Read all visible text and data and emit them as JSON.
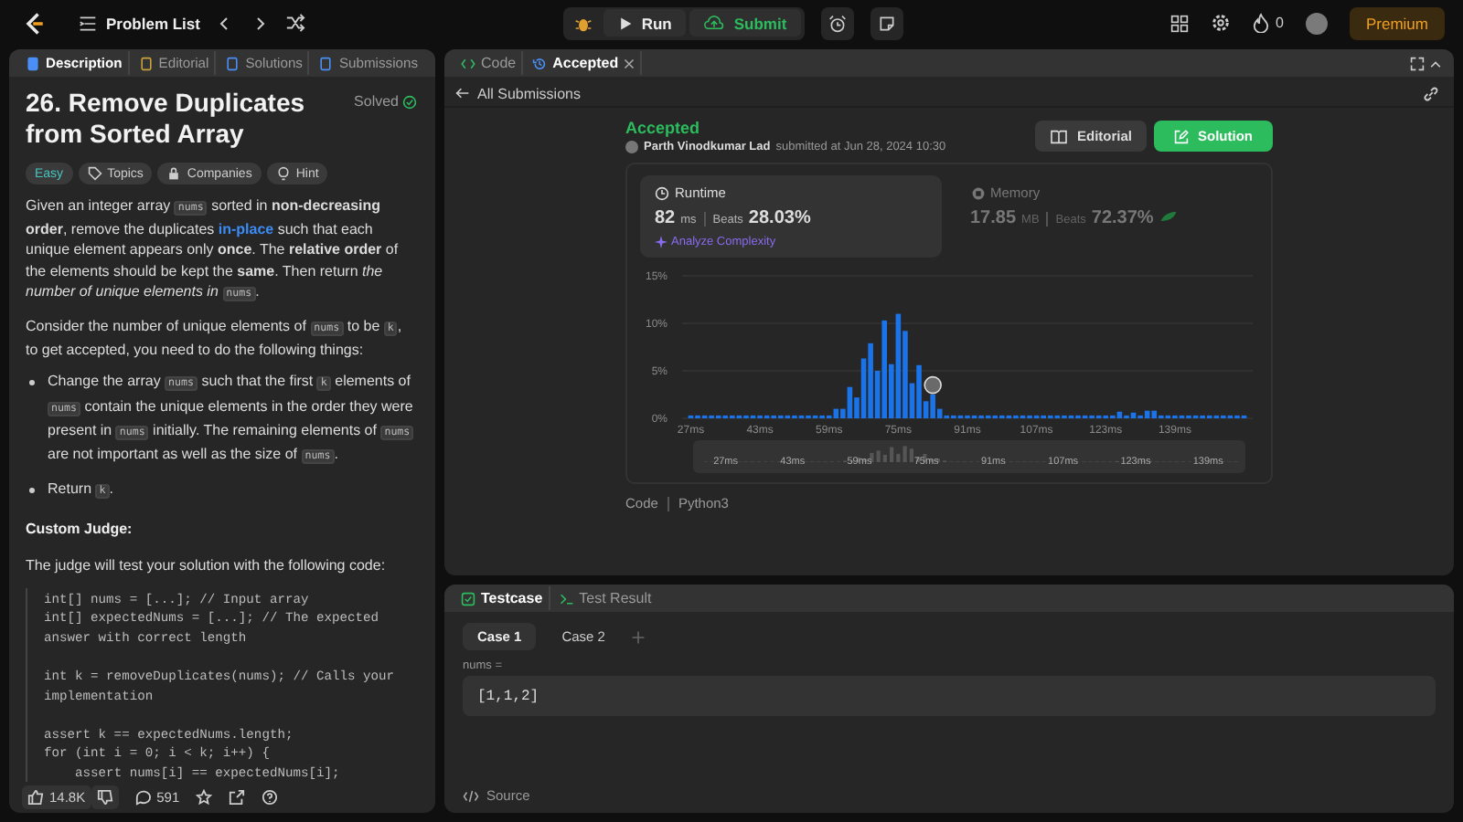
{
  "top_bar": {
    "title": "Problem List",
    "run": "Run",
    "submit": "Submit",
    "streak": "0",
    "premium": "Premium"
  },
  "left_tabs": [
    {
      "label": "Description",
      "kind": "doc",
      "selected": true
    },
    {
      "label": "Editorial",
      "kind": "book",
      "selected": false
    },
    {
      "label": "Solutions",
      "kind": "flask",
      "selected": false
    },
    {
      "label": "Submissions",
      "kind": "history",
      "selected": false
    }
  ],
  "problem": {
    "title": "26. Remove Duplicates from Sorted Array",
    "status": "Solved",
    "difficulty": "Easy",
    "tags": [
      {
        "label": "Topics",
        "kind": "tag"
      },
      {
        "label": "Companies",
        "kind": "lock"
      },
      {
        "label": "Hint",
        "kind": "bulb"
      }
    ],
    "paragraphs": [
      {
        "kind": "para",
        "segments": [
          {
            "kind": "text",
            "text": "Given an integer array "
          },
          {
            "kind": "code",
            "text": "nums"
          },
          {
            "kind": "text",
            "text": " sorted in **non-decreasing order**, remove the duplicates "
          },
          {
            "kind": "link",
            "text": "in-place"
          },
          {
            "kind": "text",
            "text": " such that each unique element appears only **once**. The **relative order** of the elements should be kept the **same**. Then return *the number of unique elements in* "
          },
          {
            "kind": "code",
            "text": "nums"
          },
          {
            "kind": "text",
            "text": "."
          }
        ]
      },
      {
        "kind": "para",
        "segments": [
          {
            "kind": "text",
            "text": "Consider the number of unique elements of "
          },
          {
            "kind": "code",
            "text": "nums"
          },
          {
            "kind": "text",
            "text": " to be "
          },
          {
            "kind": "code",
            "text": "k"
          },
          {
            "kind": "text",
            "text": ", to get accepted, you need to do the following things:"
          }
        ]
      },
      {
        "kind": "bullet",
        "segments": [
          {
            "kind": "text",
            "text": "Change the array "
          },
          {
            "kind": "code",
            "text": "nums"
          },
          {
            "kind": "text",
            "text": " such that the first "
          },
          {
            "kind": "code",
            "text": "k"
          },
          {
            "kind": "text",
            "text": " elements of "
          },
          {
            "kind": "code",
            "text": "nums"
          },
          {
            "kind": "text",
            "text": " contain the unique elements in the order they were present in "
          },
          {
            "kind": "code",
            "text": "nums"
          },
          {
            "kind": "text",
            "text": " initially. The remaining elements of "
          },
          {
            "kind": "code",
            "text": "nums"
          },
          {
            "kind": "text",
            "text": " are not important as well as the size of "
          },
          {
            "kind": "code",
            "text": "nums"
          },
          {
            "kind": "text",
            "text": "."
          }
        ]
      },
      {
        "kind": "bullet",
        "segments": [
          {
            "kind": "text",
            "text": "Return "
          },
          {
            "kind": "code",
            "text": "k"
          },
          {
            "kind": "text",
            "text": "."
          }
        ]
      }
    ],
    "judge_heading": "Custom Judge:",
    "judge_text": "The judge will test your solution with the following code:",
    "code": "int[] nums = [...]; // Input array\nint[] expectedNums = [...]; // The expected answer with correct length\n\nint k = removeDuplicates(nums); // Calls your implementation\n\nassert k == expectedNums.length;\nfor (int i = 0; i < k; i++) {\n    assert nums[i] == expectedNums[i];",
    "likes": "14.8K",
    "comments": "591"
  },
  "editor_tabs": [
    {
      "label": "Code",
      "kind": "code",
      "selected": false,
      "closable": false
    },
    {
      "label": "Accepted",
      "kind": "history",
      "selected": true,
      "closable": true
    }
  ],
  "back_link": "All Submissions",
  "submission": {
    "status": "Accepted",
    "author": "Parth Vinodkumar Lad",
    "submitted": "submitted at Jun 28, 2024 10:30",
    "buttons": [
      {
        "label": "Editorial",
        "kind": "editorial"
      },
      {
        "label": "Solution",
        "kind": "solution"
      }
    ]
  },
  "stats": [
    {
      "label": "Runtime",
      "kind": "clock",
      "selected": true,
      "value": "82",
      "unit": "ms",
      "beats_label": "Beats",
      "beats": "28.03%",
      "action": "Analyze Complexity"
    },
    {
      "label": "Memory",
      "kind": "chip",
      "selected": false,
      "value": "17.85",
      "unit": "MB",
      "beats_label": "Beats",
      "beats": "72.37%"
    }
  ],
  "chart_data": {
    "type": "bar",
    "xlim": [
      25,
      157
    ],
    "ylim": [
      0,
      15
    ],
    "x": [
      27,
      28.6,
      30.2,
      31.8,
      33.4,
      35,
      36.6,
      38.2,
      39.8,
      41.4,
      43,
      44.6,
      46.2,
      47.8,
      49.4,
      51,
      52.6,
      54.2,
      55.8,
      57.4,
      59,
      60.6,
      62.2,
      63.8,
      65.4,
      67,
      68.6,
      70.2,
      71.8,
      73.4,
      75,
      76.6,
      78.2,
      79.8,
      81.4,
      83,
      84.6,
      86.2,
      87.8,
      89.4,
      91,
      92.6,
      94.2,
      95.8,
      97.4,
      99,
      100.6,
      102.2,
      103.8,
      105.4,
      107,
      108.6,
      110.2,
      111.8,
      113.4,
      115,
      116.6,
      118.2,
      119.8,
      121.4,
      123,
      124.6,
      126.2,
      127.8,
      129.4,
      131,
      132.6,
      134.2,
      135.8,
      137.4,
      139,
      140.6,
      142.2,
      143.8,
      145.4,
      147,
      148.6,
      150.2,
      151.8,
      153.4,
      155
    ],
    "values": [
      0.3,
      0.3,
      0.3,
      0.3,
      0.3,
      0.3,
      0.3,
      0.3,
      0.3,
      0.3,
      0.3,
      0.3,
      0.3,
      0.3,
      0.3,
      0.3,
      0.3,
      0.3,
      0.3,
      0.3,
      0.3,
      1.0,
      1.0,
      3.3,
      2.2,
      6.3,
      7.9,
      5.0,
      10.3,
      5.7,
      11.0,
      9.2,
      3.7,
      5.6,
      1.8,
      2.5,
      1.0,
      0.3,
      0.3,
      0.3,
      0.3,
      0.3,
      0.3,
      0.3,
      0.3,
      0.3,
      0.3,
      0.3,
      0.3,
      0.3,
      0.3,
      0.3,
      0.3,
      0.3,
      0.3,
      0.3,
      0.3,
      0.3,
      0.3,
      0.3,
      0.3,
      0.3,
      0.7,
      0.3,
      0.6,
      0.3,
      0.8,
      0.8,
      0.3,
      0.3,
      0.3,
      0.3,
      0.3,
      0.3,
      0.3,
      0.3,
      0.3,
      0.3,
      0.3,
      0.3,
      0.3
    ],
    "xticks": [
      {
        "value": 27,
        "label": "27ms"
      },
      {
        "value": 43,
        "label": "43ms"
      },
      {
        "value": 59,
        "label": "59ms"
      },
      {
        "value": 75,
        "label": "75ms"
      },
      {
        "value": 91,
        "label": "91ms"
      },
      {
        "value": 107,
        "label": "107ms"
      },
      {
        "value": 123,
        "label": "123ms"
      },
      {
        "value": 139,
        "label": "139ms"
      }
    ],
    "yticks": [
      {
        "value": 0,
        "label": "0%"
      },
      {
        "value": 5,
        "label": "5%"
      },
      {
        "value": 10,
        "label": "10%"
      },
      {
        "value": 15,
        "label": "15%"
      }
    ]
  },
  "navigator_labels": [
    "27ms",
    "43ms",
    "59ms",
    "75ms",
    "91ms",
    "107ms",
    "123ms",
    "139ms"
  ],
  "code_footer": {
    "label": "Code",
    "language": "Python3"
  },
  "console_tabs": [
    {
      "label": "Testcase",
      "kind": "check",
      "selected": true
    },
    {
      "label": "Test Result",
      "kind": "terminal",
      "selected": false
    }
  ],
  "cases": [
    {
      "label": "Case 1",
      "selected": true
    },
    {
      "label": "Case 2",
      "selected": false
    }
  ],
  "inputs": [
    {
      "name": "nums =",
      "value": "[1,1,2]"
    }
  ],
  "source": "Source"
}
